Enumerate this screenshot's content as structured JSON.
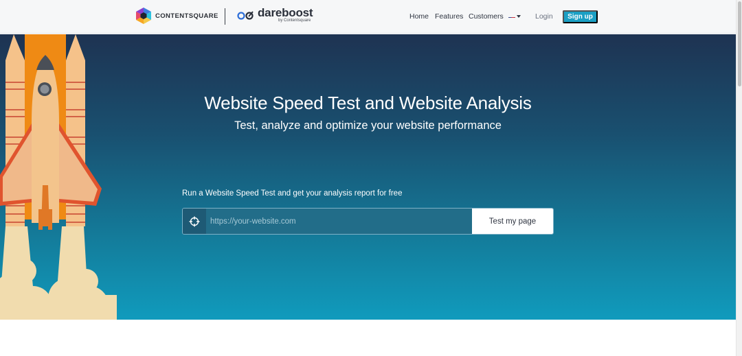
{
  "header": {
    "contentsquare_label": "CONTENTSQUARE",
    "dareboost_name": "dareboost",
    "dareboost_byline": "by Contentsquare",
    "nav": {
      "home": "Home",
      "features": "Features",
      "customers": "Customers",
      "language_icon": "us-flag-icon",
      "login": "Login",
      "signup": "Sign up"
    },
    "colors": {
      "signup_bg": "#1b9fc4"
    }
  },
  "hero": {
    "title": "Website Speed Test and Website Analysis",
    "subtitle": "Test, analyze and optimize your website performance",
    "cta_text": "Run a Website Speed Test and get your analysis report for free",
    "url_input": {
      "value": "",
      "placeholder": "https://your-website.com"
    },
    "submit_label": "Test my page",
    "icons": [
      "rocket-illustration",
      "crosshair-icon"
    ],
    "colors": {
      "gradient_top": "#1e3352",
      "gradient_bottom": "#109bbd"
    }
  }
}
